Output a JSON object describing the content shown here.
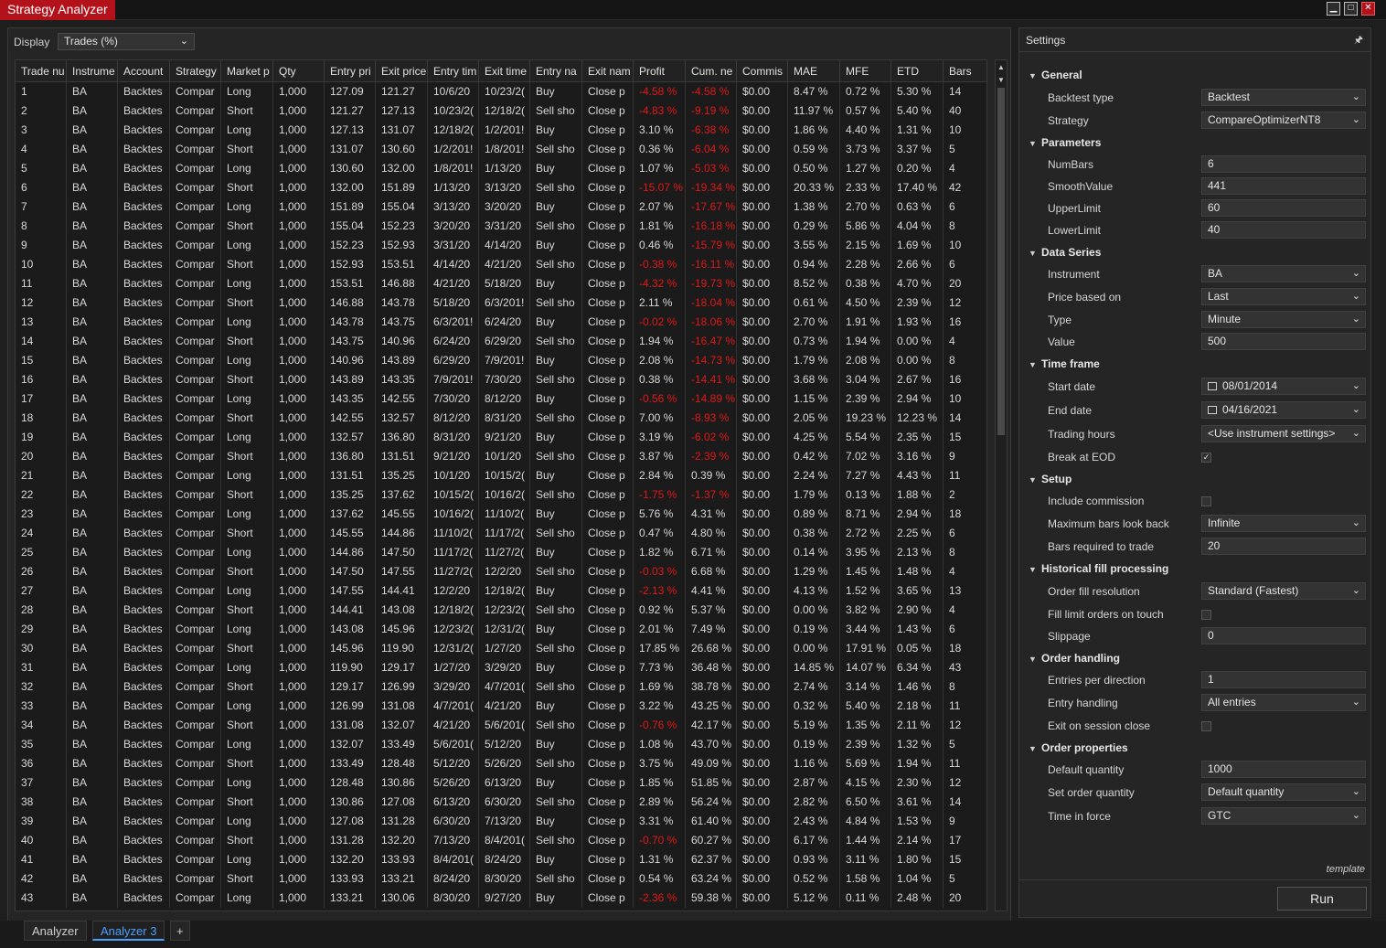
{
  "window": {
    "title": "Strategy Analyzer",
    "min_icon": "minimize-icon",
    "max_icon": "maximize-icon",
    "close_icon": "close-icon"
  },
  "display": {
    "label": "Display",
    "selected": "Trades (%)"
  },
  "grid": {
    "columns": [
      "Trade nu",
      "Instrume",
      "Account",
      "Strategy",
      "Market p",
      "Qty",
      "Entry pri",
      "Exit price",
      "Entry tim",
      "Exit time",
      "Entry na",
      "Exit nam",
      "Profit",
      "Cum. ne",
      "Commis",
      "MAE",
      "MFE",
      "ETD",
      "Bars"
    ],
    "rows": [
      [
        "1",
        "BA",
        "Backtes",
        "Compar",
        "Long",
        "1,000",
        "127.09",
        "121.27",
        "10/6/20",
        "10/23/2(",
        "Buy",
        "Close p",
        "-4.58 %",
        "-4.58 %",
        "$0.00",
        "8.47 %",
        "0.72 %",
        "5.30 %",
        "14"
      ],
      [
        "2",
        "BA",
        "Backtes",
        "Compar",
        "Short",
        "1,000",
        "121.27",
        "127.13",
        "10/23/2(",
        "12/18/2(",
        "Sell sho",
        "Close p",
        "-4.83 %",
        "-9.19 %",
        "$0.00",
        "11.97 %",
        "0.57 %",
        "5.40 %",
        "40"
      ],
      [
        "3",
        "BA",
        "Backtes",
        "Compar",
        "Long",
        "1,000",
        "127.13",
        "131.07",
        "12/18/2(",
        "1/2/201!",
        "Buy",
        "Close p",
        "3.10 %",
        "-6.38 %",
        "$0.00",
        "1.86 %",
        "4.40 %",
        "1.31 %",
        "10"
      ],
      [
        "4",
        "BA",
        "Backtes",
        "Compar",
        "Short",
        "1,000",
        "131.07",
        "130.60",
        "1/2/201!",
        "1/8/201!",
        "Sell sho",
        "Close p",
        "0.36 %",
        "-6.04 %",
        "$0.00",
        "0.59 %",
        "3.73 %",
        "3.37 %",
        "5"
      ],
      [
        "5",
        "BA",
        "Backtes",
        "Compar",
        "Long",
        "1,000",
        "130.60",
        "132.00",
        "1/8/201!",
        "1/13/20",
        "Buy",
        "Close p",
        "1.07 %",
        "-5.03 %",
        "$0.00",
        "0.50 %",
        "1.27 %",
        "0.20 %",
        "4"
      ],
      [
        "6",
        "BA",
        "Backtes",
        "Compar",
        "Short",
        "1,000",
        "132.00",
        "151.89",
        "1/13/20",
        "3/13/20",
        "Sell sho",
        "Close p",
        "-15.07 %",
        "-19.34 %",
        "$0.00",
        "20.33 %",
        "2.33 %",
        "17.40 %",
        "42"
      ],
      [
        "7",
        "BA",
        "Backtes",
        "Compar",
        "Long",
        "1,000",
        "151.89",
        "155.04",
        "3/13/20",
        "3/20/20",
        "Buy",
        "Close p",
        "2.07 %",
        "-17.67 %",
        "$0.00",
        "1.38 %",
        "2.70 %",
        "0.63 %",
        "6"
      ],
      [
        "8",
        "BA",
        "Backtes",
        "Compar",
        "Short",
        "1,000",
        "155.04",
        "152.23",
        "3/20/20",
        "3/31/20",
        "Sell sho",
        "Close p",
        "1.81 %",
        "-16.18 %",
        "$0.00",
        "0.29 %",
        "5.86 %",
        "4.04 %",
        "8"
      ],
      [
        "9",
        "BA",
        "Backtes",
        "Compar",
        "Long",
        "1,000",
        "152.23",
        "152.93",
        "3/31/20",
        "4/14/20",
        "Buy",
        "Close p",
        "0.46 %",
        "-15.79 %",
        "$0.00",
        "3.55 %",
        "2.15 %",
        "1.69 %",
        "10"
      ],
      [
        "10",
        "BA",
        "Backtes",
        "Compar",
        "Short",
        "1,000",
        "152.93",
        "153.51",
        "4/14/20",
        "4/21/20",
        "Sell sho",
        "Close p",
        "-0.38 %",
        "-16.11 %",
        "$0.00",
        "0.94 %",
        "2.28 %",
        "2.66 %",
        "6"
      ],
      [
        "11",
        "BA",
        "Backtes",
        "Compar",
        "Long",
        "1,000",
        "153.51",
        "146.88",
        "4/21/20",
        "5/18/20",
        "Buy",
        "Close p",
        "-4.32 %",
        "-19.73 %",
        "$0.00",
        "8.52 %",
        "0.38 %",
        "4.70 %",
        "20"
      ],
      [
        "12",
        "BA",
        "Backtes",
        "Compar",
        "Short",
        "1,000",
        "146.88",
        "143.78",
        "5/18/20",
        "6/3/201!",
        "Sell sho",
        "Close p",
        "2.11 %",
        "-18.04 %",
        "$0.00",
        "0.61 %",
        "4.50 %",
        "2.39 %",
        "12"
      ],
      [
        "13",
        "BA",
        "Backtes",
        "Compar",
        "Long",
        "1,000",
        "143.78",
        "143.75",
        "6/3/201!",
        "6/24/20",
        "Buy",
        "Close p",
        "-0.02 %",
        "-18.06 %",
        "$0.00",
        "2.70 %",
        "1.91 %",
        "1.93 %",
        "16"
      ],
      [
        "14",
        "BA",
        "Backtes",
        "Compar",
        "Short",
        "1,000",
        "143.75",
        "140.96",
        "6/24/20",
        "6/29/20",
        "Sell sho",
        "Close p",
        "1.94 %",
        "-16.47 %",
        "$0.00",
        "0.73 %",
        "1.94 %",
        "0.00 %",
        "4"
      ],
      [
        "15",
        "BA",
        "Backtes",
        "Compar",
        "Long",
        "1,000",
        "140.96",
        "143.89",
        "6/29/20",
        "7/9/201!",
        "Buy",
        "Close p",
        "2.08 %",
        "-14.73 %",
        "$0.00",
        "1.79 %",
        "2.08 %",
        "0.00 %",
        "8"
      ],
      [
        "16",
        "BA",
        "Backtes",
        "Compar",
        "Short",
        "1,000",
        "143.89",
        "143.35",
        "7/9/201!",
        "7/30/20",
        "Sell sho",
        "Close p",
        "0.38 %",
        "-14.41 %",
        "$0.00",
        "3.68 %",
        "3.04 %",
        "2.67 %",
        "16"
      ],
      [
        "17",
        "BA",
        "Backtes",
        "Compar",
        "Long",
        "1,000",
        "143.35",
        "142.55",
        "7/30/20",
        "8/12/20",
        "Buy",
        "Close p",
        "-0.56 %",
        "-14.89 %",
        "$0.00",
        "1.15 %",
        "2.39 %",
        "2.94 %",
        "10"
      ],
      [
        "18",
        "BA",
        "Backtes",
        "Compar",
        "Short",
        "1,000",
        "142.55",
        "132.57",
        "8/12/20",
        "8/31/20",
        "Sell sho",
        "Close p",
        "7.00 %",
        "-8.93 %",
        "$0.00",
        "2.05 %",
        "19.23 %",
        "12.23 %",
        "14"
      ],
      [
        "19",
        "BA",
        "Backtes",
        "Compar",
        "Long",
        "1,000",
        "132.57",
        "136.80",
        "8/31/20",
        "9/21/20",
        "Buy",
        "Close p",
        "3.19 %",
        "-6.02 %",
        "$0.00",
        "4.25 %",
        "5.54 %",
        "2.35 %",
        "15"
      ],
      [
        "20",
        "BA",
        "Backtes",
        "Compar",
        "Short",
        "1,000",
        "136.80",
        "131.51",
        "9/21/20",
        "10/1/20",
        "Sell sho",
        "Close p",
        "3.87 %",
        "-2.39 %",
        "$0.00",
        "0.42 %",
        "7.02 %",
        "3.16 %",
        "9"
      ],
      [
        "21",
        "BA",
        "Backtes",
        "Compar",
        "Long",
        "1,000",
        "131.51",
        "135.25",
        "10/1/20",
        "10/15/2(",
        "Buy",
        "Close p",
        "2.84 %",
        "0.39 %",
        "$0.00",
        "2.24 %",
        "7.27 %",
        "4.43 %",
        "11"
      ],
      [
        "22",
        "BA",
        "Backtes",
        "Compar",
        "Short",
        "1,000",
        "135.25",
        "137.62",
        "10/15/2(",
        "10/16/2(",
        "Sell sho",
        "Close p",
        "-1.75 %",
        "-1.37 %",
        "$0.00",
        "1.79 %",
        "0.13 %",
        "1.88 %",
        "2"
      ],
      [
        "23",
        "BA",
        "Backtes",
        "Compar",
        "Long",
        "1,000",
        "137.62",
        "145.55",
        "10/16/2(",
        "11/10/2(",
        "Buy",
        "Close p",
        "5.76 %",
        "4.31 %",
        "$0.00",
        "0.89 %",
        "8.71 %",
        "2.94 %",
        "18"
      ],
      [
        "24",
        "BA",
        "Backtes",
        "Compar",
        "Short",
        "1,000",
        "145.55",
        "144.86",
        "11/10/2(",
        "11/17/2(",
        "Sell sho",
        "Close p",
        "0.47 %",
        "4.80 %",
        "$0.00",
        "0.38 %",
        "2.72 %",
        "2.25 %",
        "6"
      ],
      [
        "25",
        "BA",
        "Backtes",
        "Compar",
        "Long",
        "1,000",
        "144.86",
        "147.50",
        "11/17/2(",
        "11/27/2(",
        "Buy",
        "Close p",
        "1.82 %",
        "6.71 %",
        "$0.00",
        "0.14 %",
        "3.95 %",
        "2.13 %",
        "8"
      ],
      [
        "26",
        "BA",
        "Backtes",
        "Compar",
        "Short",
        "1,000",
        "147.50",
        "147.55",
        "11/27/2(",
        "12/2/20",
        "Sell sho",
        "Close p",
        "-0.03 %",
        "6.68 %",
        "$0.00",
        "1.29 %",
        "1.45 %",
        "1.48 %",
        "4"
      ],
      [
        "27",
        "BA",
        "Backtes",
        "Compar",
        "Long",
        "1,000",
        "147.55",
        "144.41",
        "12/2/20",
        "12/18/2(",
        "Buy",
        "Close p",
        "-2.13 %",
        "4.41 %",
        "$0.00",
        "4.13 %",
        "1.52 %",
        "3.65 %",
        "13"
      ],
      [
        "28",
        "BA",
        "Backtes",
        "Compar",
        "Short",
        "1,000",
        "144.41",
        "143.08",
        "12/18/2(",
        "12/23/2(",
        "Sell sho",
        "Close p",
        "0.92 %",
        "5.37 %",
        "$0.00",
        "0.00 %",
        "3.82 %",
        "2.90 %",
        "4"
      ],
      [
        "29",
        "BA",
        "Backtes",
        "Compar",
        "Long",
        "1,000",
        "143.08",
        "145.96",
        "12/23/2(",
        "12/31/2(",
        "Buy",
        "Close p",
        "2.01 %",
        "7.49 %",
        "$0.00",
        "0.19 %",
        "3.44 %",
        "1.43 %",
        "6"
      ],
      [
        "30",
        "BA",
        "Backtes",
        "Compar",
        "Short",
        "1,000",
        "145.96",
        "119.90",
        "12/31/2(",
        "1/27/20",
        "Sell sho",
        "Close p",
        "17.85 %",
        "26.68 %",
        "$0.00",
        "0.00 %",
        "17.91 %",
        "0.05 %",
        "18"
      ],
      [
        "31",
        "BA",
        "Backtes",
        "Compar",
        "Long",
        "1,000",
        "119.90",
        "129.17",
        "1/27/20",
        "3/29/20",
        "Buy",
        "Close p",
        "7.73 %",
        "36.48 %",
        "$0.00",
        "14.85 %",
        "14.07 %",
        "6.34 %",
        "43"
      ],
      [
        "32",
        "BA",
        "Backtes",
        "Compar",
        "Short",
        "1,000",
        "129.17",
        "126.99",
        "3/29/20",
        "4/7/201(",
        "Sell sho",
        "Close p",
        "1.69 %",
        "38.78 %",
        "$0.00",
        "2.74 %",
        "3.14 %",
        "1.46 %",
        "8"
      ],
      [
        "33",
        "BA",
        "Backtes",
        "Compar",
        "Long",
        "1,000",
        "126.99",
        "131.08",
        "4/7/201(",
        "4/21/20",
        "Buy",
        "Close p",
        "3.22 %",
        "43.25 %",
        "$0.00",
        "0.32 %",
        "5.40 %",
        "2.18 %",
        "11"
      ],
      [
        "34",
        "BA",
        "Backtes",
        "Compar",
        "Short",
        "1,000",
        "131.08",
        "132.07",
        "4/21/20",
        "5/6/201(",
        "Sell sho",
        "Close p",
        "-0.76 %",
        "42.17 %",
        "$0.00",
        "5.19 %",
        "1.35 %",
        "2.11 %",
        "12"
      ],
      [
        "35",
        "BA",
        "Backtes",
        "Compar",
        "Long",
        "1,000",
        "132.07",
        "133.49",
        "5/6/201(",
        "5/12/20",
        "Buy",
        "Close p",
        "1.08 %",
        "43.70 %",
        "$0.00",
        "0.19 %",
        "2.39 %",
        "1.32 %",
        "5"
      ],
      [
        "36",
        "BA",
        "Backtes",
        "Compar",
        "Short",
        "1,000",
        "133.49",
        "128.48",
        "5/12/20",
        "5/26/20",
        "Sell sho",
        "Close p",
        "3.75 %",
        "49.09 %",
        "$0.00",
        "1.16 %",
        "5.69 %",
        "1.94 %",
        "11"
      ],
      [
        "37",
        "BA",
        "Backtes",
        "Compar",
        "Long",
        "1,000",
        "128.48",
        "130.86",
        "5/26/20",
        "6/13/20",
        "Buy",
        "Close p",
        "1.85 %",
        "51.85 %",
        "$0.00",
        "2.87 %",
        "4.15 %",
        "2.30 %",
        "12"
      ],
      [
        "38",
        "BA",
        "Backtes",
        "Compar",
        "Short",
        "1,000",
        "130.86",
        "127.08",
        "6/13/20",
        "6/30/20",
        "Sell sho",
        "Close p",
        "2.89 %",
        "56.24 %",
        "$0.00",
        "2.82 %",
        "6.50 %",
        "3.61 %",
        "14"
      ],
      [
        "39",
        "BA",
        "Backtes",
        "Compar",
        "Long",
        "1,000",
        "127.08",
        "131.28",
        "6/30/20",
        "7/13/20",
        "Buy",
        "Close p",
        "3.31 %",
        "61.40 %",
        "$0.00",
        "2.43 %",
        "4.84 %",
        "1.53 %",
        "9"
      ],
      [
        "40",
        "BA",
        "Backtes",
        "Compar",
        "Short",
        "1,000",
        "131.28",
        "132.20",
        "7/13/20",
        "8/4/201(",
        "Sell sho",
        "Close p",
        "-0.70 %",
        "60.27 %",
        "$0.00",
        "6.17 %",
        "1.44 %",
        "2.14 %",
        "17"
      ],
      [
        "41",
        "BA",
        "Backtes",
        "Compar",
        "Long",
        "1,000",
        "132.20",
        "133.93",
        "8/4/201(",
        "8/24/20",
        "Buy",
        "Close p",
        "1.31 %",
        "62.37 %",
        "$0.00",
        "0.93 %",
        "3.11 %",
        "1.80 %",
        "15"
      ],
      [
        "42",
        "BA",
        "Backtes",
        "Compar",
        "Short",
        "1,000",
        "133.93",
        "133.21",
        "8/24/20",
        "8/30/20",
        "Sell sho",
        "Close p",
        "0.54 %",
        "63.24 %",
        "$0.00",
        "0.52 %",
        "1.58 %",
        "1.04 %",
        "5"
      ],
      [
        "43",
        "BA",
        "Backtes",
        "Compar",
        "Long",
        "1,000",
        "133.21",
        "130.06",
        "8/30/20",
        "9/27/20",
        "Buy",
        "Close p",
        "-2.36 %",
        "59.38 %",
        "$0.00",
        "5.12 %",
        "0.11 %",
        "2.48 %",
        "20"
      ]
    ]
  },
  "tabs": [
    {
      "label": "Analyzer"
    },
    {
      "label": "Analyzer 3"
    }
  ],
  "add_tab": "+",
  "settings": {
    "title": "Settings",
    "template": "template",
    "run": "Run",
    "sections": [
      {
        "name": "General",
        "props": [
          {
            "label": "Backtest type",
            "value": "Backtest",
            "kind": "select"
          },
          {
            "label": "Strategy",
            "value": "CompareOptimizerNT8",
            "kind": "select"
          }
        ]
      },
      {
        "name": "Parameters",
        "props": [
          {
            "label": "NumBars",
            "value": "6",
            "kind": "text"
          },
          {
            "label": "SmoothValue",
            "value": "441",
            "kind": "text"
          },
          {
            "label": "UpperLimit",
            "value": "60",
            "kind": "text"
          },
          {
            "label": "LowerLimit",
            "value": "40",
            "kind": "text"
          }
        ]
      },
      {
        "name": "Data Series",
        "props": [
          {
            "label": "Instrument",
            "value": "BA",
            "kind": "select"
          },
          {
            "label": "Price based on",
            "value": "Last",
            "kind": "select"
          },
          {
            "label": "Type",
            "value": "Minute",
            "kind": "select"
          },
          {
            "label": "Value",
            "value": "500",
            "kind": "text"
          }
        ]
      },
      {
        "name": "Time frame",
        "props": [
          {
            "label": "Start date",
            "value": "08/01/2014",
            "kind": "date"
          },
          {
            "label": "End date",
            "value": "04/16/2021",
            "kind": "date"
          },
          {
            "label": "Trading hours",
            "value": "<Use instrument settings>",
            "kind": "select"
          },
          {
            "label": "Break at EOD",
            "value": "✓",
            "kind": "check"
          }
        ]
      },
      {
        "name": "Setup",
        "props": [
          {
            "label": "Include commission",
            "value": "",
            "kind": "check"
          },
          {
            "label": "Maximum bars look back",
            "value": "Infinite",
            "kind": "select"
          },
          {
            "label": "Bars required to trade",
            "value": "20",
            "kind": "text"
          }
        ]
      },
      {
        "name": "Historical fill processing",
        "props": [
          {
            "label": "Order fill resolution",
            "value": "Standard (Fastest)",
            "kind": "select"
          },
          {
            "label": "Fill limit orders on touch",
            "value": "",
            "kind": "check"
          },
          {
            "label": "Slippage",
            "value": "0",
            "kind": "text"
          }
        ]
      },
      {
        "name": "Order handling",
        "props": [
          {
            "label": "Entries per direction",
            "value": "1",
            "kind": "text"
          },
          {
            "label": "Entry handling",
            "value": "All entries",
            "kind": "select"
          },
          {
            "label": "Exit on session close",
            "value": "",
            "kind": "check"
          }
        ]
      },
      {
        "name": "Order properties",
        "props": [
          {
            "label": "Default quantity",
            "value": "1000",
            "kind": "text"
          },
          {
            "label": "Set order quantity",
            "value": "Default quantity",
            "kind": "select"
          },
          {
            "label": "Time in force",
            "value": "GTC",
            "kind": "select"
          }
        ]
      }
    ]
  },
  "colors": {
    "accent": "#4a9fff",
    "negative": "#e01818",
    "title_tab": "#b3121b"
  }
}
